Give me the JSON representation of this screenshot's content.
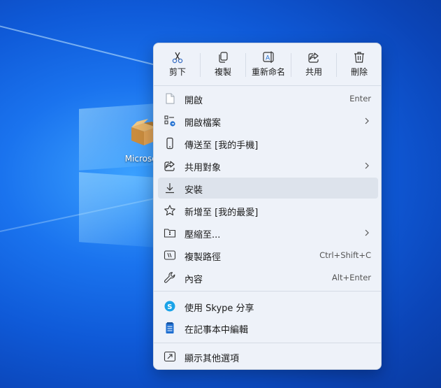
{
  "desktop": {
    "icon_label": "Microsoft"
  },
  "menu": {
    "toolbar": [
      {
        "id": "cut",
        "label": "剪下",
        "icon": "scissors-icon"
      },
      {
        "id": "copy",
        "label": "複製",
        "icon": "copy-icon"
      },
      {
        "id": "rename",
        "label": "重新命名",
        "icon": "rename-icon"
      },
      {
        "id": "share",
        "label": "共用",
        "icon": "share-icon"
      },
      {
        "id": "delete",
        "label": "刪除",
        "icon": "trash-icon"
      }
    ],
    "items": [
      {
        "label": "開啟",
        "shortcut": "Enter",
        "icon": "open-file-icon"
      },
      {
        "label": "開啟檔案",
        "submenu": true,
        "icon": "open-with-icon"
      },
      {
        "label": "傳送至 [我的手機]",
        "icon": "phone-icon"
      },
      {
        "label": "共用對象",
        "submenu": true,
        "icon": "share-with-icon"
      },
      {
        "label": "安裝",
        "icon": "download-icon",
        "hover": true
      },
      {
        "label": "新增至 [我的最愛]",
        "icon": "star-icon"
      },
      {
        "label": "壓縮至...",
        "submenu": true,
        "icon": "zip-folder-icon"
      },
      {
        "label": "複製路徑",
        "shortcut": "Ctrl+Shift+C",
        "icon": "copy-path-icon"
      },
      {
        "label": "內容",
        "shortcut": "Alt+Enter",
        "icon": "wrench-icon"
      },
      {
        "label": "使用 Skype 分享",
        "icon": "skype-icon"
      },
      {
        "label": "在記事本中編輯",
        "icon": "notepad-icon"
      },
      {
        "label": "顯示其他選項",
        "icon": "more-options-icon"
      }
    ],
    "colors": {
      "accent": "#1f6fd1",
      "skype": "#1aa3e8"
    }
  }
}
